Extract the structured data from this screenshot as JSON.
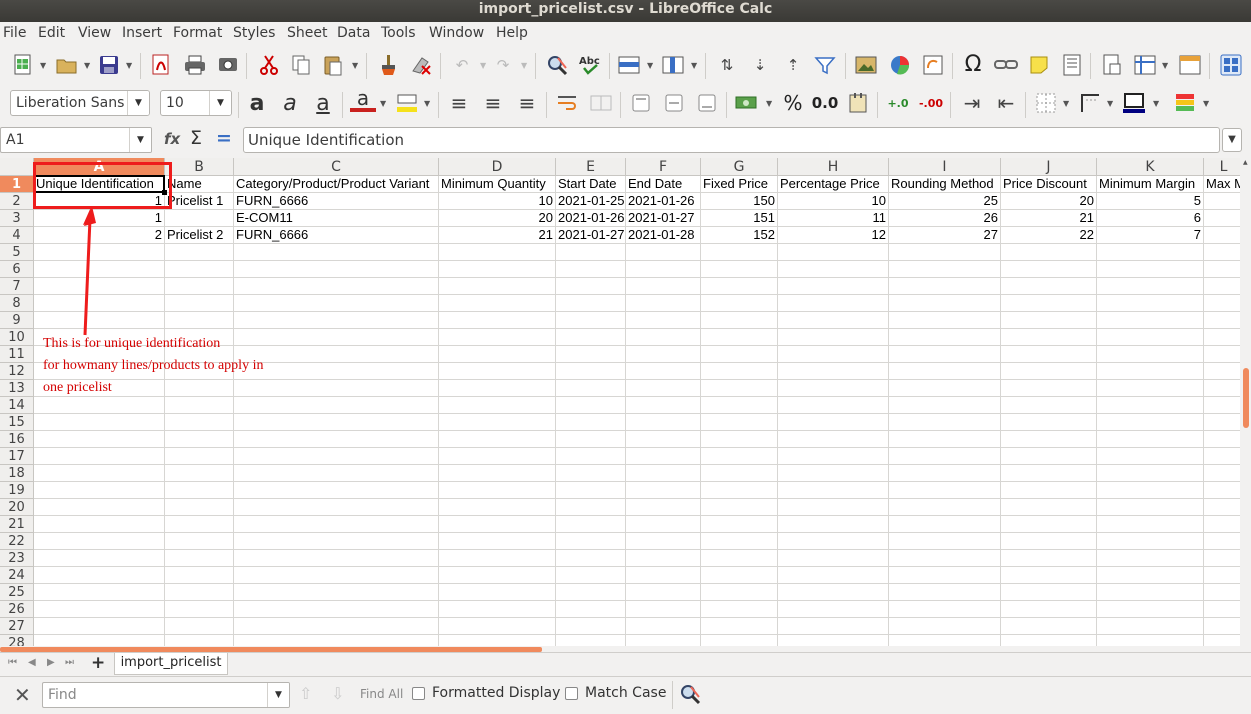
{
  "window": {
    "title": "import_pricelist.csv - LibreOffice Calc"
  },
  "menu": [
    "File",
    "Edit",
    "View",
    "Insert",
    "Format",
    "Styles",
    "Sheet",
    "Data",
    "Tools",
    "Window",
    "Help"
  ],
  "toolbar2": {
    "font_name": "Liberation Sans",
    "font_size": "10",
    "bold_glyph": "a",
    "italic_glyph": "a",
    "underline_glyph": "a",
    "font_color_glyph": "a",
    "percent_glyph": "%",
    "number_format": "0.0"
  },
  "formula_bar": {
    "name_box": "A1",
    "function_wizard_glyph": "fx",
    "sum_glyph": "Σ",
    "equals_glyph": "=",
    "content": "Unique Identification"
  },
  "sheet": {
    "columns": [
      "A",
      "B",
      "C",
      "D",
      "E",
      "F",
      "G",
      "H",
      "I",
      "J",
      "K",
      "L"
    ],
    "active_column": "A",
    "active_row": 1,
    "row_numbers": [
      "1",
      "2",
      "3",
      "4",
      "5",
      "6",
      "7",
      "8",
      "9",
      "10",
      "11",
      "12",
      "13",
      "14",
      "15",
      "16",
      "17",
      "18",
      "19",
      "20",
      "21",
      "22",
      "23",
      "24",
      "25",
      "26",
      "27",
      "28"
    ],
    "header_row": [
      "Unique Identification",
      "Name",
      "Category/Product/Product Variant",
      "Minimum Quantity",
      "Start Date",
      "End Date",
      "Fixed Price",
      "Percentage Price",
      "Rounding Method",
      "Price Discount",
      "Minimum Margin",
      "Max M"
    ],
    "rows": [
      [
        "1",
        "Pricelist 1",
        "FURN_6666",
        "10",
        "2021-01-25",
        "2021-01-26",
        "150",
        "10",
        "25",
        "20",
        "5",
        ""
      ],
      [
        "1",
        "",
        "E-COM11",
        "20",
        "2021-01-26",
        "2021-01-27",
        "151",
        "11",
        "26",
        "21",
        "6",
        ""
      ],
      [
        "2",
        "Pricelist 2",
        "FURN_6666",
        "21",
        "2021-01-27",
        "2021-01-28",
        "152",
        "12",
        "27",
        "22",
        "7",
        ""
      ]
    ]
  },
  "annotation": {
    "lines": [
      "This is for unique identification",
      "for howmany lines/products to apply in",
      "one pricelist"
    ],
    "color": "#d40000"
  },
  "sheet_tabs": {
    "active": "import_pricelist",
    "add_glyph": "+"
  },
  "find_bar": {
    "placeholder": "Find",
    "find_all": "Find All",
    "formatted_display": "Formatted Display",
    "match_case": "Match Case"
  },
  "colors": {
    "accent": "#f08a5d",
    "annotation": "#ee1c1c"
  }
}
